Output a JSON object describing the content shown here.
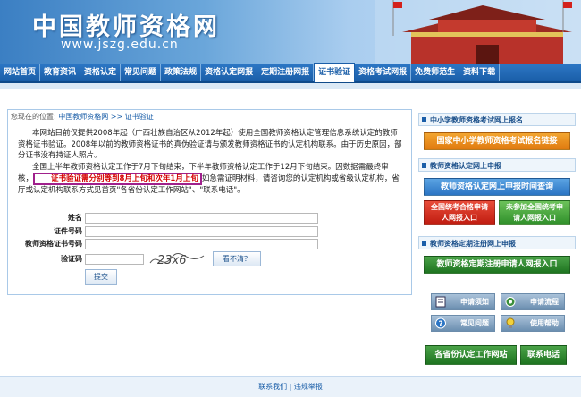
{
  "header": {
    "logo": "中国教师资格网",
    "url": "www.jszg.edu.cn"
  },
  "nav": {
    "items": [
      "网站首页",
      "教育资讯",
      "资格认定",
      "常见问题",
      "政策法规",
      "资格认定网报",
      "定期注册网报",
      "证书验证",
      "资格考试网报",
      "免费师范生",
      "资料下载"
    ]
  },
  "breadcrumb": {
    "prefix": "您现在的位置:",
    "home": "中国教师资格网",
    "sep": ">>",
    "current": "证书验证"
  },
  "content": {
    "para1": "本网站目前仅提供2008年起（广西壮族自治区从2012年起）使用全国教师资格认定管理信息系统认定的教师资格证书验证。2008年以前的教师资格证书的真伪验证请与颁发教师资格证书的认定机构联系。由于历史原因，部分证书没有持证人照片。",
    "para2_a": "全国上半年教师资格认定工作于7月下旬结束，下半年教师资格认定工作于12月下旬结束。因数据需最终审核，",
    "notice": "证书验证需分别等到8月上旬和次年1月上旬",
    "para2_b": "如急需证明材料，请咨询您的认定机构或省级认定机构，省厅或认定机构联系方式见首页\"各省份认定工作网站\"、\"联系电话\"。"
  },
  "form": {
    "name_label": "姓名",
    "id_label": "证件号码",
    "cert_label": "教师资格证书号码",
    "captcha_label": "验证码",
    "captcha_text": "23x6",
    "unclear_label": "看不清？",
    "submit_label": "提交"
  },
  "sidebar": {
    "sec1_title": "中小学教师资格考试网上报名",
    "sec1_btn": "国家中小学教师资格考试报名链接",
    "sec2_title": "教师资格认定网上申报",
    "sec2_btn": "教师资格认定网上申报时间查询",
    "sec2_btn_left": "全国统考合格申请人网报入口",
    "sec2_btn_right": "未参加全国统考申请人网报入口",
    "sec3_title": "教师资格定期注册网上申报",
    "sec3_btn": "教师资格定期注册申请人网报入口",
    "icon_btns": [
      "申请须知",
      "申请流程",
      "常见问题",
      "使用帮助"
    ],
    "bottom_left": "各省份认定工作网站",
    "bottom_right": "联系电话"
  },
  "footer": {
    "contact": "联系我们",
    "sep": "|",
    "report": "违规举报"
  },
  "colors": {
    "nav": "#1a5ea8",
    "notice_border": "#a0208c",
    "notice_text": "#d40000"
  }
}
